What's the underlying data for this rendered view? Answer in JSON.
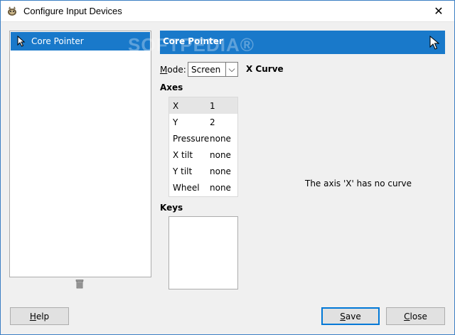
{
  "window": {
    "title": "Configure Input Devices",
    "close_glyph": "✕"
  },
  "devices": [
    {
      "name": "Core Pointer",
      "icon": "pointer-icon"
    }
  ],
  "device_header": {
    "name": "Core Pointer",
    "watermark": "SOFTPEDIA®"
  },
  "mode": {
    "label_first": "M",
    "label_rest": "ode:",
    "value": "Screen",
    "arrow": "⌵"
  },
  "axes": {
    "label": "Axes",
    "rows": [
      {
        "axis": "X",
        "value": "1"
      },
      {
        "axis": "Y",
        "value": "2"
      },
      {
        "axis": "Pressure",
        "value": "none"
      },
      {
        "axis": "X tilt",
        "value": "none"
      },
      {
        "axis": "Y tilt",
        "value": "none"
      },
      {
        "axis": "Wheel",
        "value": "none"
      }
    ]
  },
  "keys": {
    "label": "Keys"
  },
  "curve": {
    "title": "X Curve",
    "message": "The axis 'X' has no curve"
  },
  "buttons": {
    "help": {
      "accel": "H",
      "rest": "elp"
    },
    "save": {
      "accel": "S",
      "rest": "ave"
    },
    "close": {
      "accel": "C",
      "rest": "lose"
    }
  },
  "colors": {
    "selection": "#1979ca",
    "window_bg": "#f0f0f0"
  }
}
